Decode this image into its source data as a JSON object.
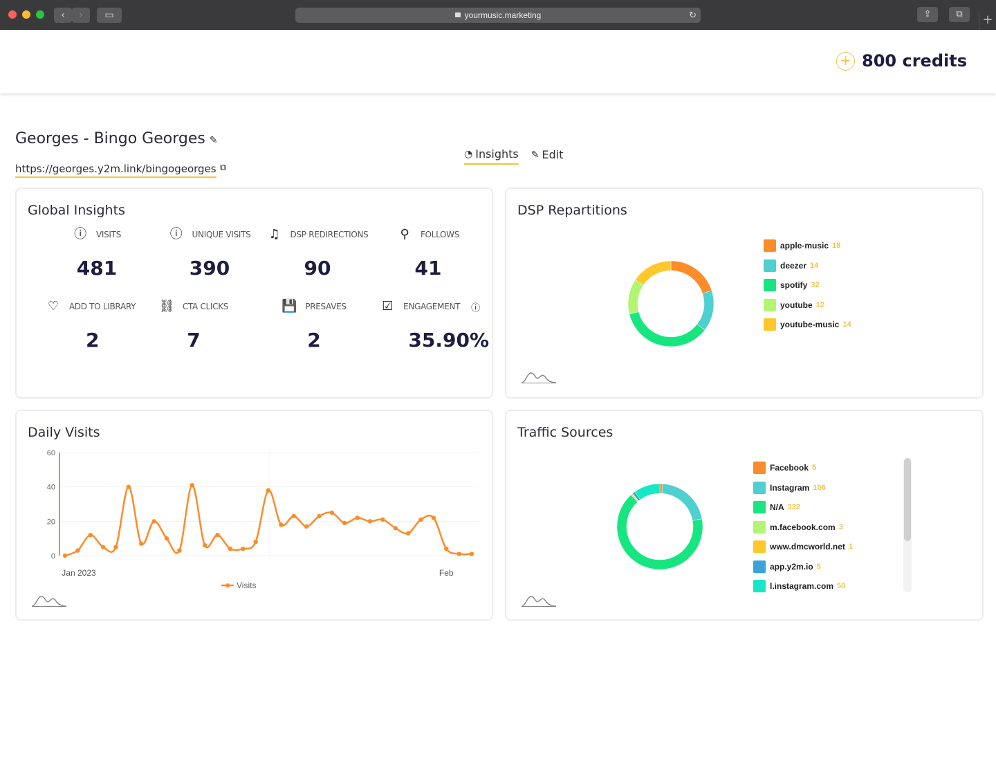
{
  "browser": {
    "url": "yourmusic.marketing"
  },
  "header": {
    "credits": "800 credits"
  },
  "page": {
    "title": "Georges - Bingo Georges",
    "link": "https://georges.y2m.link/bingogeorges",
    "tabs": [
      {
        "label": "Insights",
        "active": true
      },
      {
        "label": "Edit",
        "active": false
      }
    ]
  },
  "global_insights": {
    "title": "Global Insights",
    "stats": [
      {
        "label": "VISITS",
        "value": "481",
        "icon": "info-circle-icon"
      },
      {
        "label": "UNIQUE VISITS",
        "value": "390",
        "icon": "info-circle-icon"
      },
      {
        "label": "DSP REDIRECTIONS",
        "value": "90",
        "icon": "music-note-icon"
      },
      {
        "label": "FOLLOWS",
        "value": "41",
        "icon": "user-check-icon"
      },
      {
        "label": "ADD TO LIBRARY",
        "value": "2",
        "icon": "heart-icon"
      },
      {
        "label": "CTA CLICKS",
        "value": "7",
        "icon": "link-icon"
      },
      {
        "label": "PRESAVES",
        "value": "2",
        "icon": "save-icon"
      },
      {
        "label": "ENGAGEMENT",
        "value": "35.90%",
        "icon": "checkbox-icon"
      }
    ]
  },
  "dsp": {
    "title": "DSP Repartitions"
  },
  "daily_visits": {
    "title": "Daily Visits"
  },
  "traffic": {
    "title": "Traffic Sources"
  },
  "colors": {
    "accent": "#f5c244",
    "orange": "#fb8c2a",
    "teal": "#4ecfd0",
    "green": "#17e680",
    "lightgreen": "#b3f572",
    "yellow": "#fec72d",
    "blue": "#3ba3d8",
    "cyan": "#16e8c5"
  },
  "chart_data": [
    {
      "type": "pie",
      "title": "DSP Repartitions",
      "categories": [
        "apple-music",
        "deezer",
        "spotify",
        "youtube",
        "youtube-music"
      ],
      "values": [
        18,
        14,
        32,
        12,
        14
      ],
      "colors": [
        "#fb8c2a",
        "#4ecfd0",
        "#17e680",
        "#b3f572",
        "#fec72d"
      ],
      "donut": true
    },
    {
      "type": "line",
      "title": "Daily Visits",
      "x_tick_labels": [
        "Jan 2023",
        "Feb"
      ],
      "ylim": [
        0,
        60
      ],
      "y_ticks": [
        0,
        20,
        40,
        60
      ],
      "series": [
        {
          "name": "Visits",
          "values": [
            0,
            3,
            12,
            5,
            5,
            40,
            7,
            20,
            10,
            3,
            41,
            6,
            12,
            4,
            4,
            8,
            38,
            18,
            23,
            17,
            23,
            25,
            19,
            22,
            20,
            21,
            16,
            13,
            21,
            22,
            4,
            1,
            1
          ]
        }
      ],
      "grid": true,
      "legend": "bottom"
    },
    {
      "type": "pie",
      "title": "Traffic Sources",
      "categories": [
        "Facebook",
        "Instagram",
        "N/A",
        "m.facebook.com",
        "www.dmcworld.net",
        "app.y2m.io",
        "l.instagram.com"
      ],
      "values": [
        5,
        106,
        332,
        3,
        1,
        5,
        50
      ],
      "colors": [
        "#fb8c2a",
        "#4ecfd0",
        "#17e680",
        "#b3f572",
        "#fec72d",
        "#3ba3d8",
        "#16e8c5"
      ],
      "donut": true
    }
  ]
}
